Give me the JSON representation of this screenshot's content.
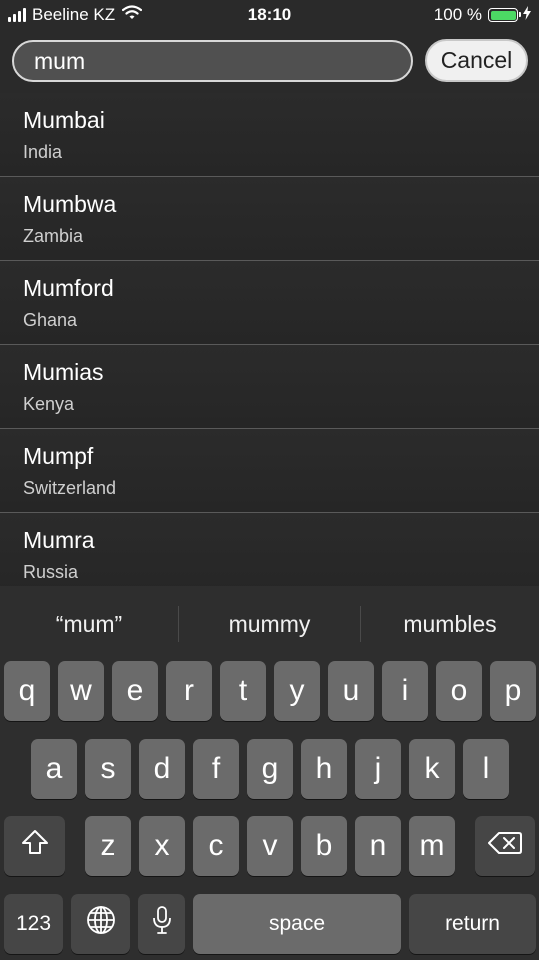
{
  "status_bar": {
    "carrier": "Beeline KZ",
    "time": "18:10",
    "battery_percent": "100 %",
    "icons": [
      "signal-icon",
      "wifi-icon",
      "battery-icon",
      "charging-bolt-icon"
    ],
    "battery_color": "#4cd964"
  },
  "search": {
    "value": "mum",
    "cancel_label": "Cancel"
  },
  "results": [
    {
      "city": "Mumbai",
      "country": "India"
    },
    {
      "city": "Mumbwa",
      "country": "Zambia"
    },
    {
      "city": "Mumford",
      "country": "Ghana"
    },
    {
      "city": "Mumias",
      "country": "Kenya"
    },
    {
      "city": "Mumpf",
      "country": "Switzerland"
    },
    {
      "city": "Mumra",
      "country": "Russia"
    }
  ],
  "keyboard": {
    "suggestions": [
      "“mum”",
      "mummy",
      "mumbles"
    ],
    "row1": [
      "q",
      "w",
      "e",
      "r",
      "t",
      "y",
      "u",
      "i",
      "o",
      "p"
    ],
    "row2": [
      "a",
      "s",
      "d",
      "f",
      "g",
      "h",
      "j",
      "k",
      "l"
    ],
    "row3": [
      "z",
      "x",
      "c",
      "v",
      "b",
      "n",
      "m"
    ],
    "numbers_label": "123",
    "space_label": "space",
    "return_label": "return",
    "icons": [
      "shift-icon",
      "backspace-icon",
      "globe-icon",
      "microphone-icon"
    ]
  }
}
